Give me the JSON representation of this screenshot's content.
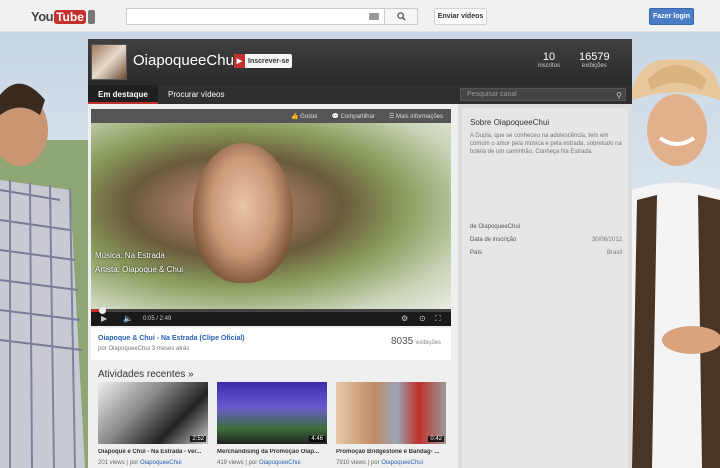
{
  "header": {
    "logo_text": "You",
    "logo_tube": "Tube",
    "upload_label": "Enviar vídeos",
    "login_label": "Fazer login"
  },
  "channel": {
    "name": "OiapoqueeChui",
    "subscribe_label": "Inscrever-se",
    "stats": [
      {
        "value": "10",
        "label": "inscritos"
      },
      {
        "value": "16579",
        "label": "exibições"
      }
    ],
    "tabs": [
      "Em destaque",
      "Procurar vídeos"
    ],
    "search_placeholder": "Pesquisar canal"
  },
  "player": {
    "actions": [
      "Gostei",
      "Compartilhar",
      "Mais informações"
    ],
    "overlay_line1": "Música: Na Estrada",
    "overlay_line2": "Artista: Oiapoque & Chui",
    "time": "0:05 / 2:49",
    "progress": 0.03
  },
  "featured": {
    "title": "Oiapoque & Chui - Na Estrada (Clipe Oficial)",
    "by": "por OiapoqueeChui 3 meses atrás",
    "views": "8035",
    "views_label": "exibições"
  },
  "activity": {
    "heading": "Atividades recentes »",
    "items": [
      {
        "title": "Oiapoque e Chuí - Na Estrada - ver...",
        "views": "201 views",
        "by": "por",
        "author": "OiapoqueeChui",
        "duration": "2:52"
      },
      {
        "title": "Merchandising da Promoção Olap...",
        "views": "419 views",
        "by": "por",
        "author": "OiapoqueeChui",
        "duration": "4:46"
      },
      {
        "title": "Promoção Bridgestone e Bandag- ...",
        "views": "7910 views",
        "by": "por",
        "author": "OiapoqueeChui",
        "duration": "0:42"
      }
    ]
  },
  "about": {
    "heading": "Sobre OiapoqueeChui",
    "text": "A Dupla, que se conheceu na adolescência, tem em comum o amor pela música e pela estrada, sobretudo na boleia de um caminhão. Conheça Na Estrada.",
    "by": "de OiapoqueeChui",
    "rows": [
      {
        "label": "Data de inscrição",
        "value": "30/06/2012"
      },
      {
        "label": "País",
        "value": "Brasil"
      }
    ]
  }
}
